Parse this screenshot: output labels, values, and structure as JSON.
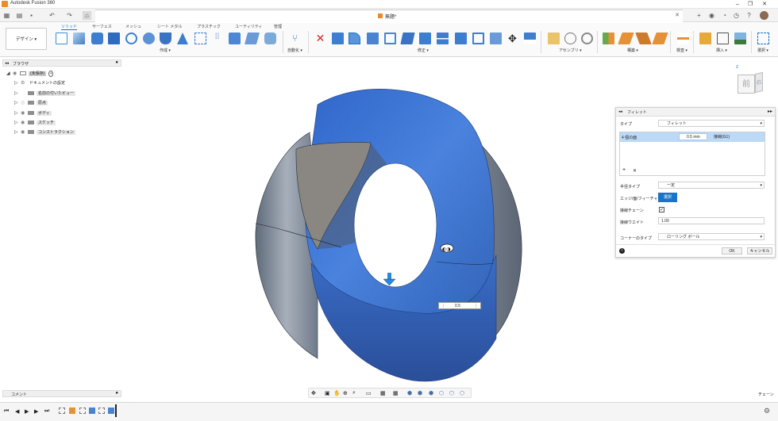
{
  "window": {
    "title": "Autodesk Fusion 360",
    "controls": [
      "–",
      "❐",
      "✕"
    ]
  },
  "document_tab": {
    "name": "無題*"
  },
  "toolbar": {
    "workspace": "デザイン ▾",
    "tabs": [
      "ソリッド",
      "サーフェス",
      "メッシュ",
      "シート メタル",
      "プラスチック",
      "ユーティリティ",
      "管理"
    ],
    "active_tab": "ソリッド",
    "groups": [
      "作成 ▾",
      "自動化 ▾",
      "修正 ▾",
      "アセンブリ ▾",
      "構築 ▾",
      "検査 ▾",
      "挿入 ▾",
      "選択 ▾"
    ]
  },
  "browser": {
    "title": "ブラウザ",
    "root": "(未保存)",
    "items": [
      "ドキュメントの設定",
      "名前の付いたビュー",
      "原点",
      "ボディ",
      "スケッチ",
      "コンストラクション"
    ]
  },
  "fillet_dialog": {
    "title": "フィレット",
    "type_label": "タイプ",
    "type_value": "フィレット",
    "selection_count": "4 個の面",
    "radius_value": "0.5 mm",
    "continuity": "接線(G1)",
    "radius_type_label": "半径タイプ",
    "radius_type_value": "一定",
    "edge_face_label": "エッジ/面/フィーチャ",
    "select_button": "選択",
    "tangent_chain_label": "接線チェーン",
    "tangent_weight_label": "接線ウエイト",
    "tangent_weight_value": "1.00",
    "corner_type_label": "コーナーのタイプ",
    "corner_type_value": "ローリング ボール",
    "ok": "OK",
    "cancel": "キャンセル",
    "add": "+",
    "remove": "✕"
  },
  "viewport": {
    "value_input": "0.5",
    "viewcube_front": "前",
    "viewcube_right": "右"
  },
  "comments": {
    "title": "コメント"
  },
  "status": {
    "right": "チェーン"
  },
  "colors": {
    "accent": "#1a73c7",
    "body_blue": "#3a6fd0",
    "body_gray": "#7a8594",
    "selection_row": "#bcd9f7"
  }
}
